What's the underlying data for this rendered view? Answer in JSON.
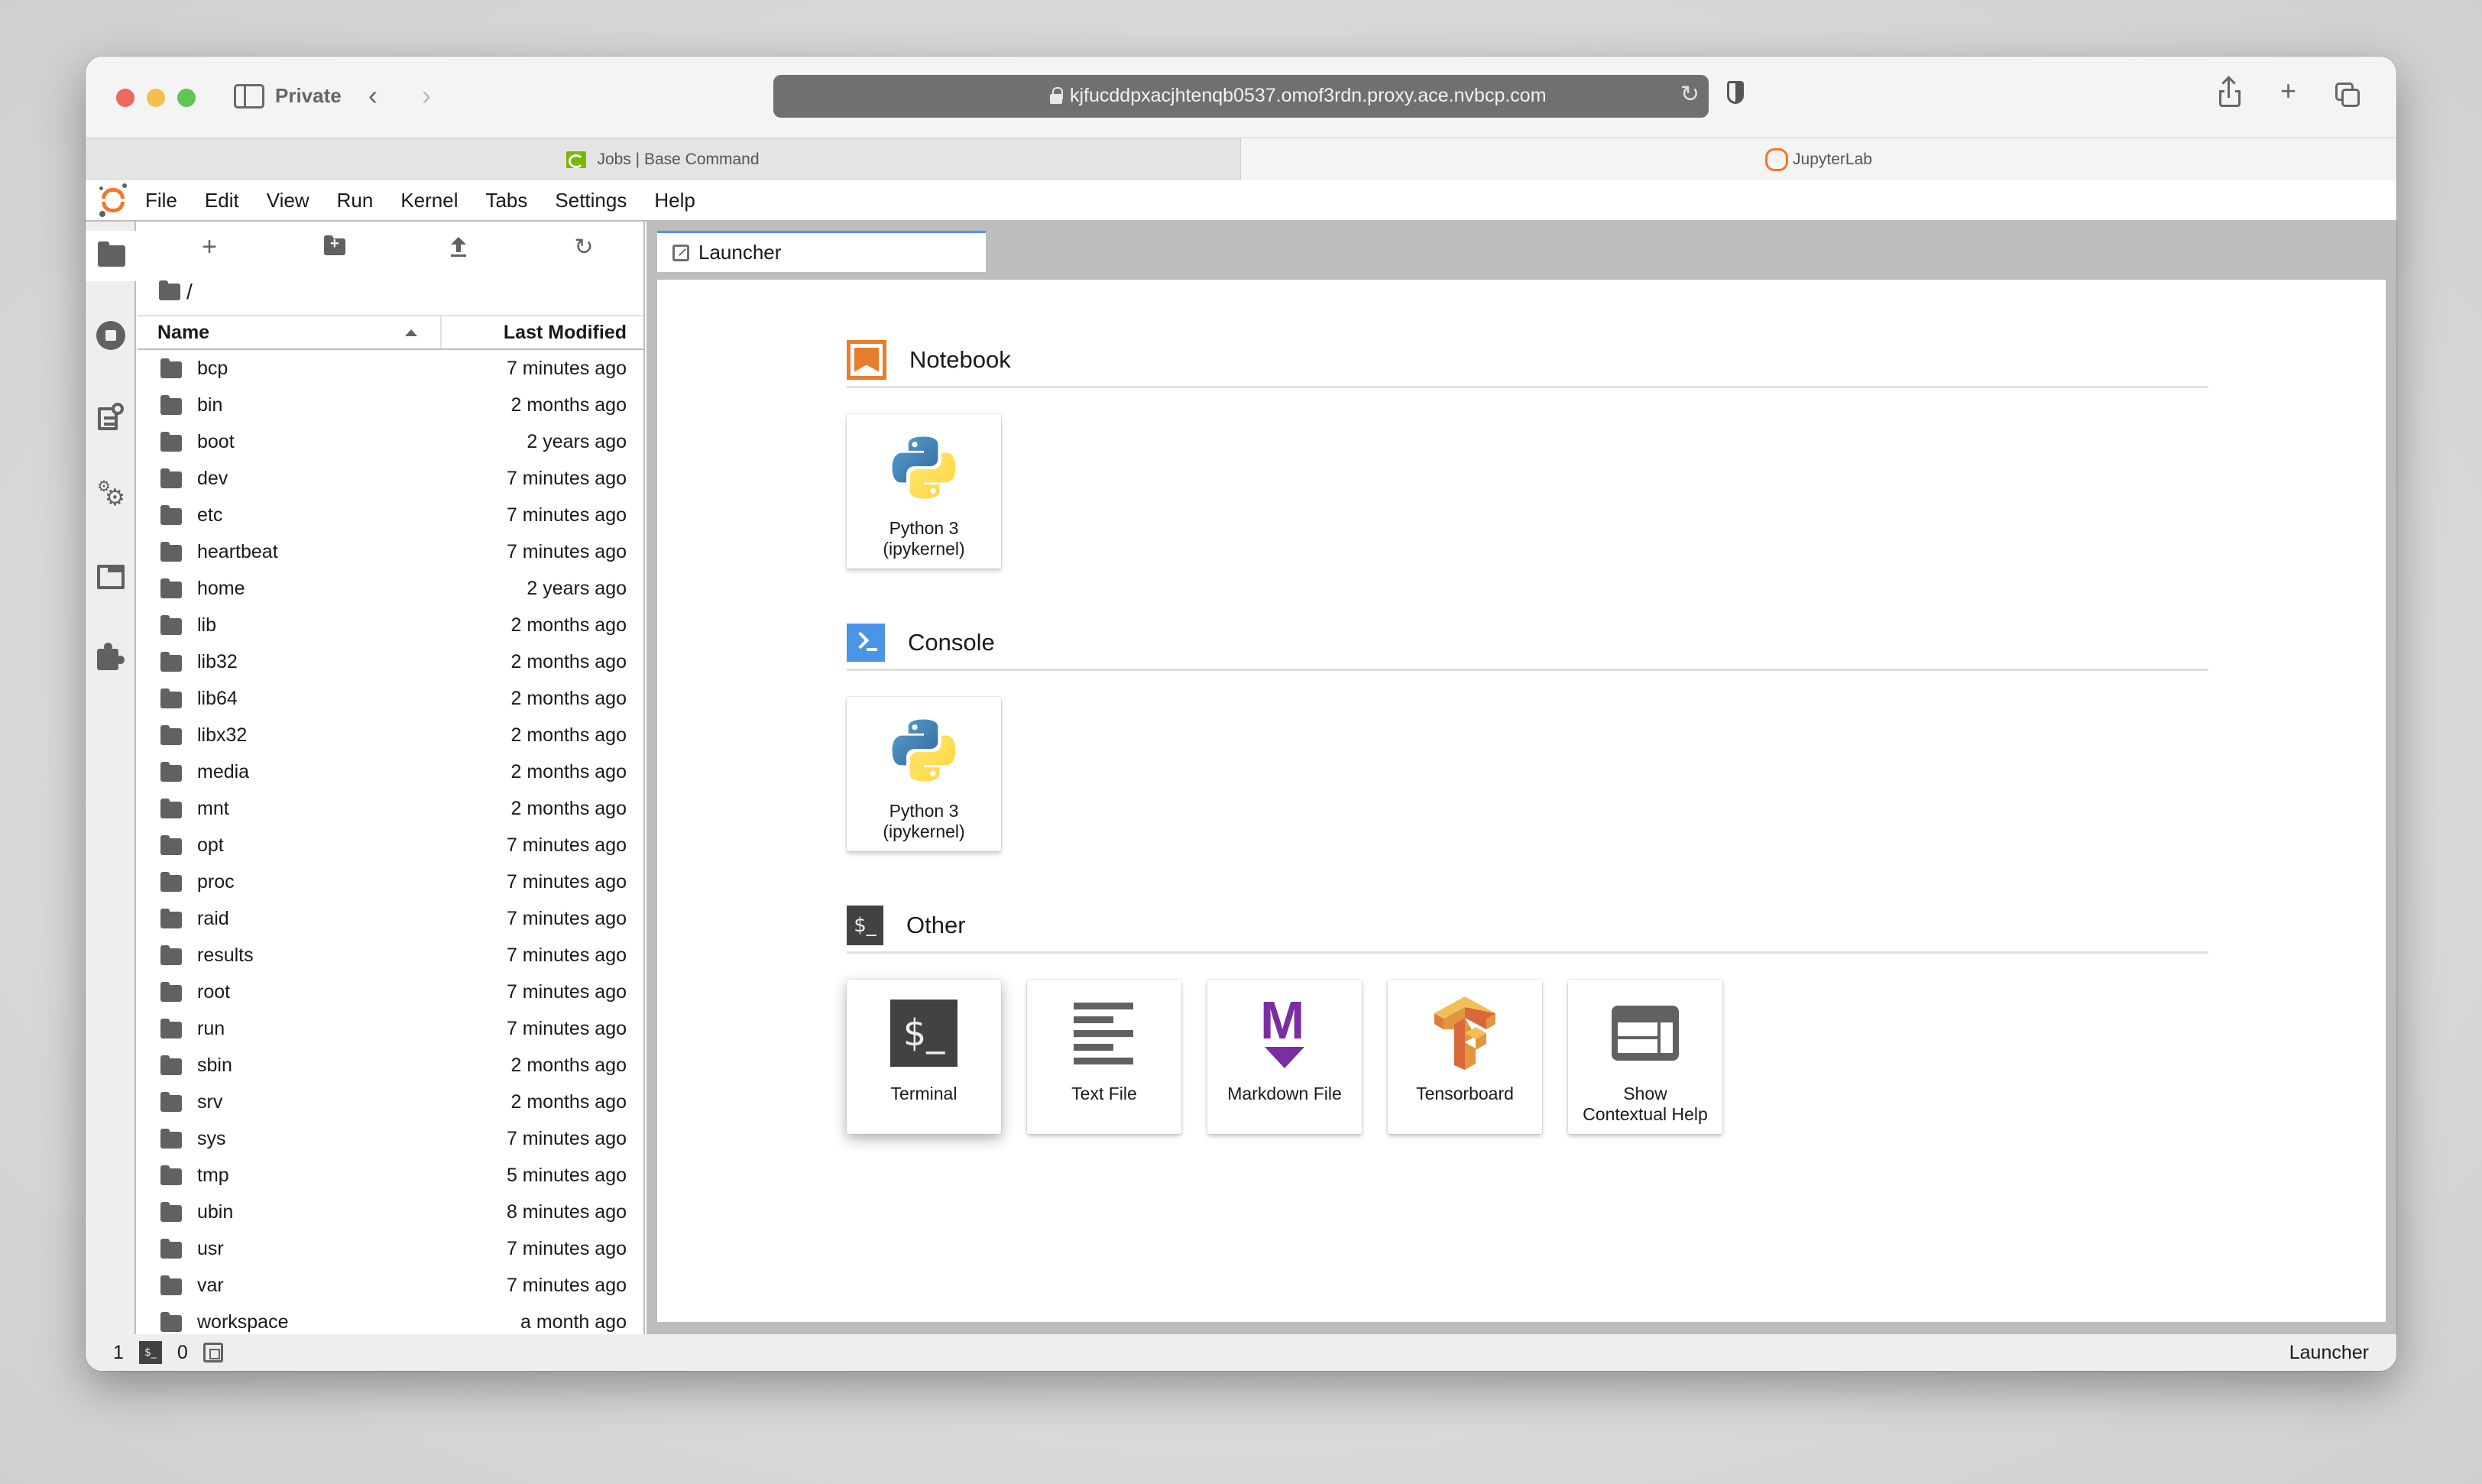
{
  "browser": {
    "private_label": "Private",
    "url": "kjfucddpxacjhtenqb0537.omof3rdn.proxy.ace.nvbcp.com",
    "tabs": [
      {
        "label": "Jobs | Base Command",
        "icon": "nvidia-icon",
        "active": false
      },
      {
        "label": "JupyterLab",
        "icon": "jupyter-icon",
        "active": true
      }
    ]
  },
  "menubar": {
    "items": [
      "File",
      "Edit",
      "View",
      "Run",
      "Kernel",
      "Tabs",
      "Settings",
      "Help"
    ]
  },
  "leftbar": {
    "items": [
      "file-browser",
      "running-terminals-kernels",
      "table-of-contents",
      "property-inspector",
      "tabs-list",
      "extension-manager"
    ],
    "active": "file-browser"
  },
  "filebrowser": {
    "toolbar": {
      "new_launcher": "+",
      "refresh_glyph": "↻"
    },
    "breadcrumb": "/",
    "columns": {
      "name": "Name",
      "modified": "Last Modified"
    },
    "sort": {
      "column": "Name",
      "direction": "ascending"
    },
    "files": [
      {
        "name": "bcp",
        "modified": "7 minutes ago"
      },
      {
        "name": "bin",
        "modified": "2 months ago"
      },
      {
        "name": "boot",
        "modified": "2 years ago"
      },
      {
        "name": "dev",
        "modified": "7 minutes ago"
      },
      {
        "name": "etc",
        "modified": "7 minutes ago"
      },
      {
        "name": "heartbeat",
        "modified": "7 minutes ago"
      },
      {
        "name": "home",
        "modified": "2 years ago"
      },
      {
        "name": "lib",
        "modified": "2 months ago"
      },
      {
        "name": "lib32",
        "modified": "2 months ago"
      },
      {
        "name": "lib64",
        "modified": "2 months ago"
      },
      {
        "name": "libx32",
        "modified": "2 months ago"
      },
      {
        "name": "media",
        "modified": "2 months ago"
      },
      {
        "name": "mnt",
        "modified": "2 months ago"
      },
      {
        "name": "opt",
        "modified": "7 minutes ago"
      },
      {
        "name": "proc",
        "modified": "7 minutes ago"
      },
      {
        "name": "raid",
        "modified": "7 minutes ago"
      },
      {
        "name": "results",
        "modified": "7 minutes ago"
      },
      {
        "name": "root",
        "modified": "7 minutes ago"
      },
      {
        "name": "run",
        "modified": "7 minutes ago"
      },
      {
        "name": "sbin",
        "modified": "2 months ago"
      },
      {
        "name": "srv",
        "modified": "2 months ago"
      },
      {
        "name": "sys",
        "modified": "7 minutes ago"
      },
      {
        "name": "tmp",
        "modified": "5 minutes ago"
      },
      {
        "name": "ubin",
        "modified": "8 minutes ago"
      },
      {
        "name": "usr",
        "modified": "7 minutes ago"
      },
      {
        "name": "var",
        "modified": "7 minutes ago"
      },
      {
        "name": "workspace",
        "modified": "a month ago"
      }
    ]
  },
  "main": {
    "tab": {
      "label": "Launcher"
    },
    "launcher": {
      "sections": [
        {
          "title": "Notebook",
          "icon": "notebook-icon",
          "cards": [
            {
              "label_line1": "Python 3",
              "label_line2": "(ipykernel)",
              "icon": "python-icon"
            }
          ]
        },
        {
          "title": "Console",
          "icon": "console-icon",
          "cards": [
            {
              "label_line1": "Python 3",
              "label_line2": "(ipykernel)",
              "icon": "python-icon"
            }
          ]
        },
        {
          "title": "Other",
          "icon": "terminal-section-icon",
          "cards": [
            {
              "label_line1": "Terminal",
              "label_line2": "",
              "icon": "terminal-icon"
            },
            {
              "label_line1": "Text File",
              "label_line2": "",
              "icon": "text-file-icon"
            },
            {
              "label_line1": "Markdown File",
              "label_line2": "",
              "icon": "markdown-icon"
            },
            {
              "label_line1": "Tensorboard",
              "label_line2": "",
              "icon": "tensorboard-icon"
            },
            {
              "label_line1": "Show",
              "label_line2": "Contextual Help",
              "icon": "contextual-help-icon"
            }
          ]
        }
      ]
    }
  },
  "statusbar": {
    "terminals_count": "1",
    "terminal_glyph": "$_",
    "kernels_count": "0",
    "right_label": "Launcher"
  },
  "colors": {
    "jupyter_orange": "#f37726",
    "notebook_orange": "#e67e2e",
    "console_blue": "#4a95e6",
    "markdown_purple": "#7b2da3",
    "active_tab_accent": "#4a95e6",
    "nvidia_green": "#76b900"
  }
}
